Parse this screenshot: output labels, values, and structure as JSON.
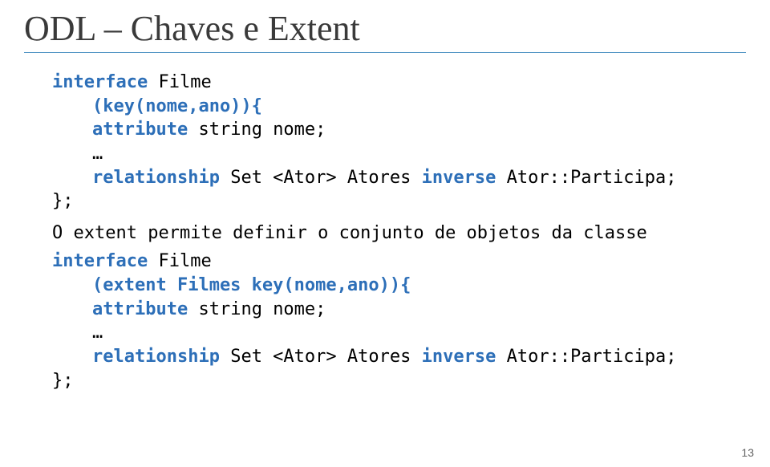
{
  "title": "ODL – Chaves e Extent",
  "block1": {
    "line1_pre": "interface",
    "line1_post": " Filme",
    "line2": "(key(nome,ano)){",
    "line3_pre": "attribute",
    "line3_mid": " string ",
    "line3_post": "nome;",
    "line4_ellipsis": "…",
    "line4_pre": "relationship",
    "line4_mid": " Set <Ator> Atores ",
    "line4_kw2": "inverse",
    "line4_post": " Ator::Participa;",
    "line5": "};"
  },
  "extent_text": "O extent permite definir o conjunto de objetos da classe",
  "block2": {
    "line1_pre": "interface",
    "line1_post": " Filme",
    "line2": "(extent Filmes key(nome,ano)){",
    "line3_pre": "attribute",
    "line3_mid": " string ",
    "line3_post": "nome;",
    "line4_ellipsis": "…",
    "line4_pre": "relationship",
    "line4_mid": " Set <Ator> Atores ",
    "line4_kw2": "inverse",
    "line4_post": " Ator::Participa;",
    "line5": "};"
  },
  "page_number": "13"
}
